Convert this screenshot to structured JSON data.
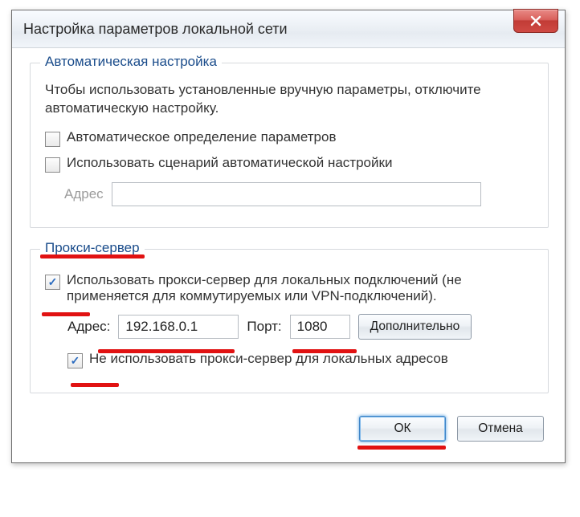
{
  "window": {
    "title": "Настройка параметров локальной сети"
  },
  "auto": {
    "legend": "Автоматическая настройка",
    "help": "Чтобы использовать установленные вручную параметры, отключите автоматическую настройку.",
    "detect_label": "Автоматическое определение параметров",
    "script_label": "Использовать сценарий автоматической настройки",
    "address_label": "Адрес",
    "address_value": ""
  },
  "proxy": {
    "legend": "Прокси-сервер",
    "use_proxy_label": "Использовать прокси-сервер для локальных подключений (не применяется для коммутируемых или VPN-подключений).",
    "address_label": "Адрес:",
    "address_value": "192.168.0.1",
    "port_label": "Порт:",
    "port_value": "1080",
    "advanced_label": "Дополнительно",
    "bypass_local_label": "Не использовать прокси-сервер для локальных адресов"
  },
  "buttons": {
    "ok": "ОК",
    "cancel": "Отмена"
  },
  "checkboxes": {
    "auto_detect": false,
    "use_script": false,
    "use_proxy": true,
    "bypass_local": true
  }
}
